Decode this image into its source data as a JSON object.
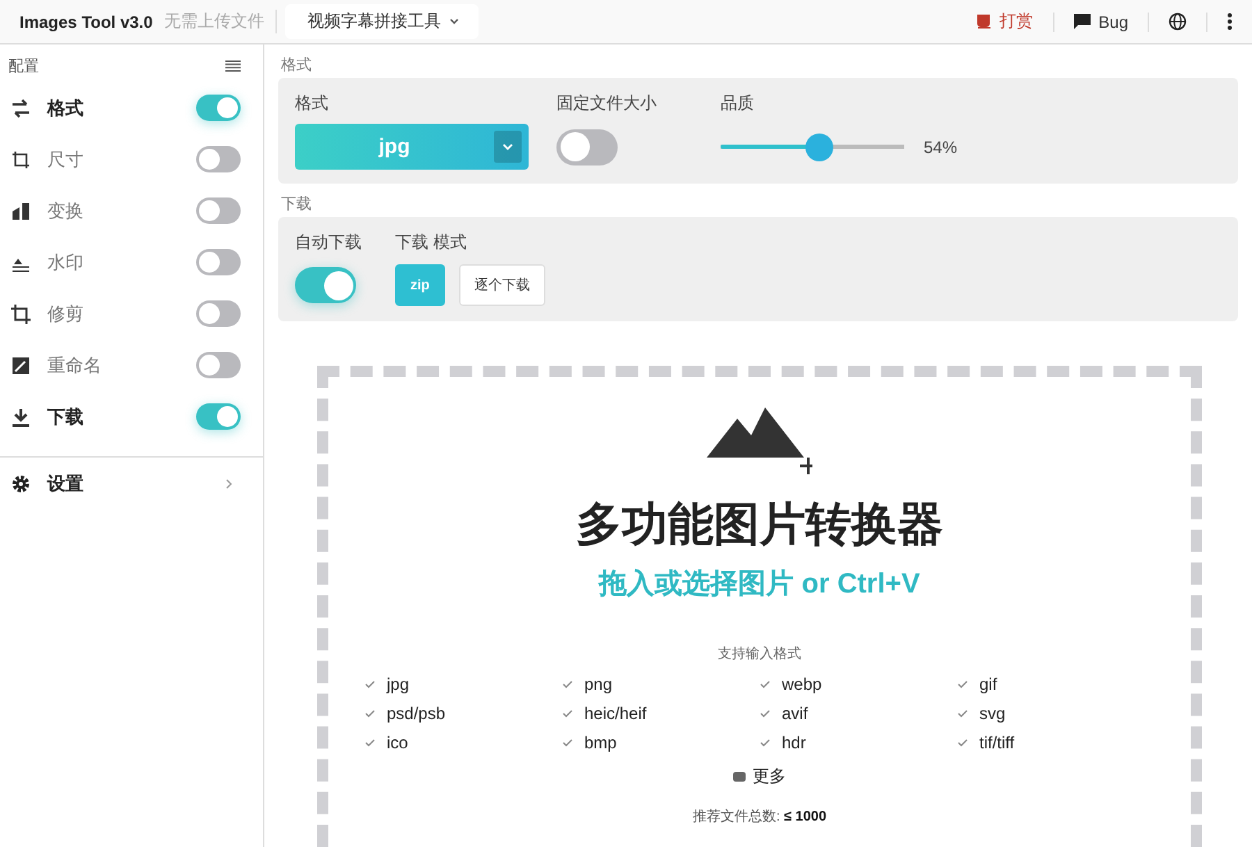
{
  "topbar": {
    "app_name": "Images Tool v3.0",
    "tagline": "无需上传文件",
    "tool_menu": "视频字幕拼接工具",
    "donate": "打赏",
    "bug": "Bug"
  },
  "sidebar": {
    "title": "配置",
    "items": [
      {
        "label": "格式",
        "on": true
      },
      {
        "label": "尺寸",
        "on": false
      },
      {
        "label": "变换",
        "on": false
      },
      {
        "label": "水印",
        "on": false
      },
      {
        "label": "修剪",
        "on": false
      },
      {
        "label": "重命名",
        "on": false
      },
      {
        "label": "下载",
        "on": true
      }
    ],
    "settings": "设置"
  },
  "format_section": {
    "title": "格式",
    "format_label": "格式",
    "format_value": "jpg",
    "fixed_size_label": "固定文件大小",
    "fixed_size_on": false,
    "quality_label": "品质",
    "quality": {
      "level": 0.54,
      "reading": "54%"
    }
  },
  "download_section": {
    "title": "下载",
    "auto_label": "自动下载",
    "auto_on": true,
    "mode_label": "下载 模式",
    "modes": [
      {
        "label": "zip",
        "selected": true
      },
      {
        "label": "逐个下载",
        "selected": false
      }
    ]
  },
  "drop_zone": {
    "title": "多功能图片转换器",
    "subtitle": "拖入或选择图片 or Ctrl+V",
    "formats_label": "支持输入格式",
    "formats": [
      "jpg",
      "png",
      "webp",
      "gif",
      "psd/psb",
      "heic/heif",
      "avif",
      "svg",
      "ico",
      "bmp",
      "hdr",
      "tif/tiff"
    ],
    "more": "更多",
    "limit_label": "推荐文件总数:",
    "limit_value": "≤ 1000"
  }
}
